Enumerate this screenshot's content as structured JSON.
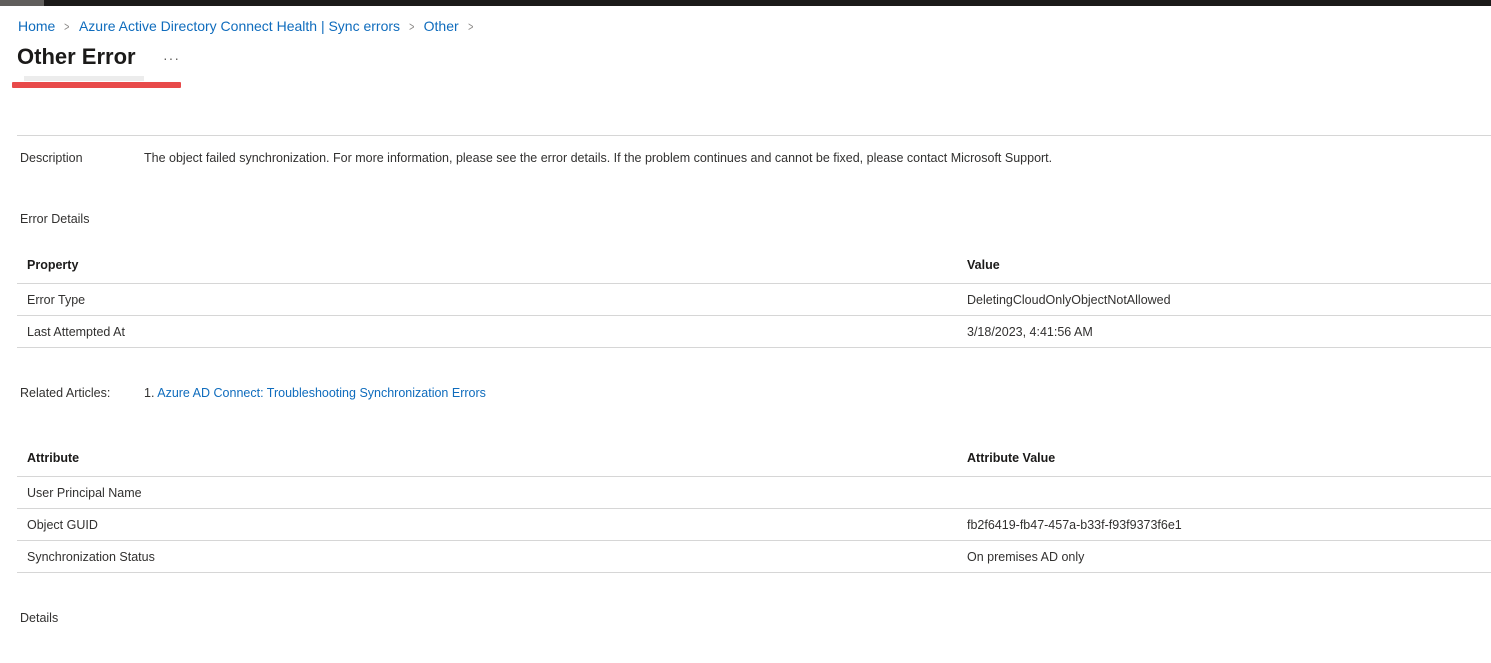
{
  "breadcrumb": [
    {
      "label": "Home"
    },
    {
      "label": "Azure Active Directory Connect Health | Sync errors"
    },
    {
      "label": "Other"
    }
  ],
  "page": {
    "title": "Other Error",
    "more_icon": "ellipsis-icon"
  },
  "description": {
    "label": "Description",
    "text": "The object failed synchronization. For more information, please see the error details. If the problem continues and cannot be fixed, please contact Microsoft Support."
  },
  "error_details": {
    "label": "Error Details",
    "columns": [
      "Property",
      "Value"
    ],
    "rows": [
      {
        "property": "Error Type",
        "value": "DeletingCloudOnlyObjectNotAllowed"
      },
      {
        "property": "Last Attempted At",
        "value": "3/18/2023, 4:41:56 AM"
      }
    ]
  },
  "related_articles": {
    "label": "Related Articles:",
    "items": [
      {
        "number": "1.",
        "title": "Azure AD Connect: Troubleshooting Synchronization Errors"
      }
    ]
  },
  "attributes": {
    "columns": [
      "Attribute",
      "Attribute Value"
    ],
    "rows": [
      {
        "attribute": "User Principal Name",
        "value": ""
      },
      {
        "attribute": "Object GUID",
        "value": "fb2f6419-fb47-457a-b33f-f93f9373f6e1"
      },
      {
        "attribute": "Synchronization Status",
        "value": "On premises AD only"
      }
    ]
  },
  "details": {
    "label": "Details"
  },
  "colors": {
    "link": "#0f6cbd",
    "redaction": "#e84a4a",
    "border": "#d6d6d6"
  }
}
